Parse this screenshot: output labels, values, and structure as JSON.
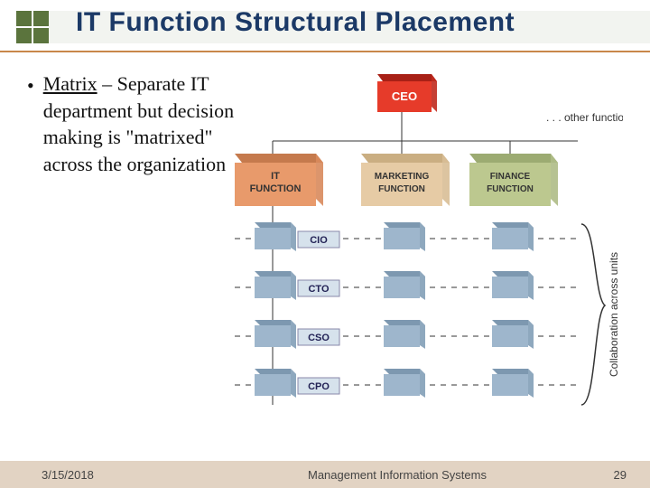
{
  "title": "IT Function Structural Placement",
  "bullet": {
    "lead": "Matrix",
    "dash": " – ",
    "rest": "Separate IT department but decision making is \"matrixed\" across the organization"
  },
  "diagram": {
    "ceo": "CEO",
    "other": ". . . other functions",
    "functions": [
      "IT FUNCTION",
      "MARKETING FUNCTION",
      "FINANCE FUNCTION"
    ],
    "roles": [
      "CIO",
      "CTO",
      "CSO",
      "CPO"
    ],
    "side": "Collaboration across units"
  },
  "footer": {
    "date": "3/15/2018",
    "course": "Management Information Systems",
    "page": "29"
  },
  "colors": {
    "ceo": "#e63b2a",
    "itfn": "#e89a6b",
    "mkfn": "#e6cba5",
    "fifn": "#bcc88f",
    "role": "#9eb6cc",
    "rolelabel": "#d6e2ec",
    "line": "#6aa8c4"
  }
}
